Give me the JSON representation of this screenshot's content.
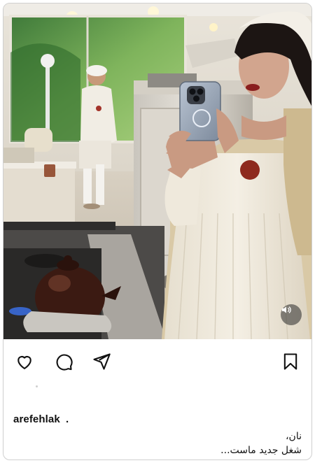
{
  "post": {
    "username": "arefehlak",
    "separator": ".",
    "caption_lines": [
      "نان،",
      "شغل جدید ماست..."
    ]
  },
  "media": {
    "description_icon": "bakery-photo",
    "sound_icon": "speaker-icon"
  },
  "actions": {
    "like_icon": "heart-icon",
    "comment_icon": "comment-icon",
    "share_icon": "send-icon",
    "save_icon": "bookmark-icon"
  },
  "colors": {
    "icon": "#111111",
    "border": "#cfcfcf",
    "apron": "#efe9dc",
    "shirt": "#d9c9a6"
  }
}
